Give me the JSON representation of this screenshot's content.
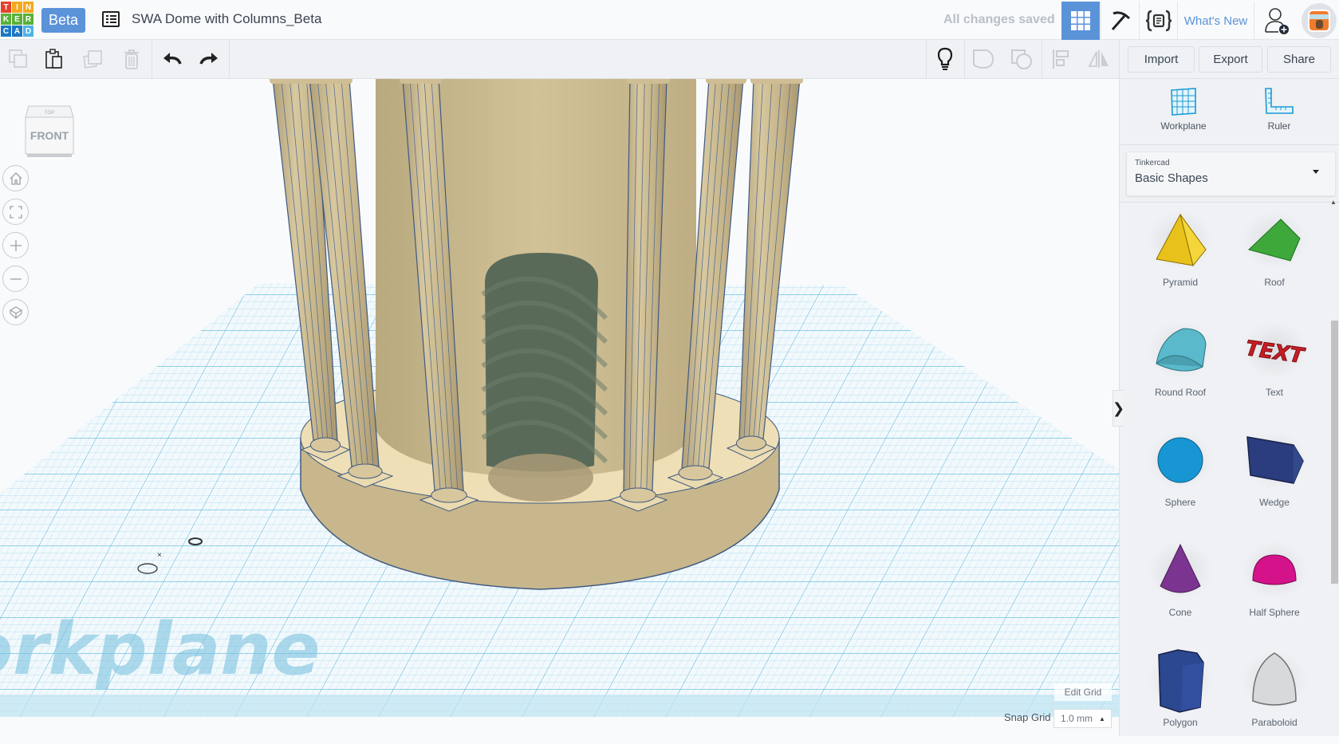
{
  "header": {
    "logo_letters": [
      "T",
      "I",
      "N",
      "K",
      "E",
      "R",
      "C",
      "A",
      "D"
    ],
    "logo_colors": [
      "#e5412d",
      "#f4a81d",
      "#f4a81d",
      "#5bb038",
      "#5bb038",
      "#5bb038",
      "#1c77c3",
      "#1c77c3",
      "#4fb3e5"
    ],
    "beta_label": "Beta",
    "design_title": "SWA Dome with Columns_Beta",
    "save_status": "All changes saved",
    "whats_new_label": "What's New",
    "accent_color": "#5b93d9"
  },
  "toolbar": {
    "import_label": "Import",
    "export_label": "Export",
    "share_label": "Share"
  },
  "viewport": {
    "viewcube_front": "FRONT",
    "viewcube_top": "TOP",
    "workplane_watermark": "Workplane",
    "edit_grid_label": "Edit Grid",
    "snap_grid_label": "Snap Grid",
    "snap_grid_value": "1.0 mm"
  },
  "sidebar": {
    "workplane_label": "Workplane",
    "ruler_label": "Ruler",
    "library_category": "Tinkercad",
    "library_selected": "Basic Shapes",
    "shapes": [
      {
        "label": "Pyramid",
        "color": "#e8c21a"
      },
      {
        "label": "Roof",
        "color": "#3ea83a"
      },
      {
        "label": "Round Roof",
        "color": "#5ab9cb"
      },
      {
        "label": "Text",
        "color": "#c81d25"
      },
      {
        "label": "Sphere",
        "color": "#1796d3"
      },
      {
        "label": "Wedge",
        "color": "#2b3d7f"
      },
      {
        "label": "Cone",
        "color": "#7b3490"
      },
      {
        "label": "Half Sphere",
        "color": "#d4128a"
      },
      {
        "label": "Polygon",
        "color": "#2b4890"
      },
      {
        "label": "Paraboloid",
        "color": "#d8d9db"
      }
    ]
  }
}
